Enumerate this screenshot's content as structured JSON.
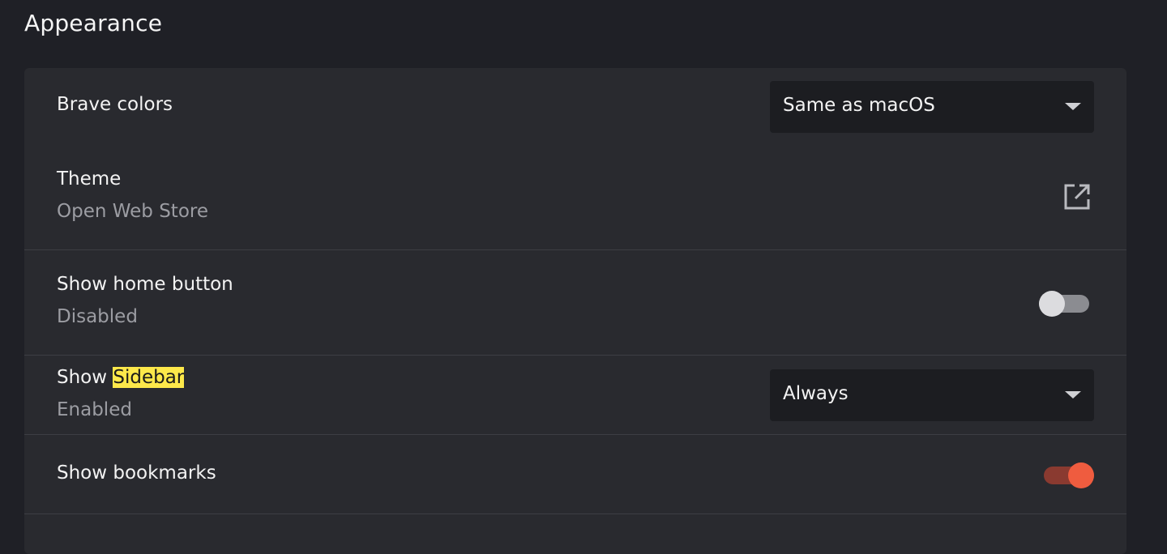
{
  "section": {
    "title": "Appearance"
  },
  "settings": {
    "brave_colors": {
      "label": "Brave colors",
      "value": "Same as macOS"
    },
    "theme": {
      "label": "Theme",
      "sublabel": "Open Web Store",
      "icon": "external-link-icon"
    },
    "home_button": {
      "label": "Show home button",
      "sublabel": "Disabled",
      "enabled": false
    },
    "sidebar": {
      "label_prefix": "Show",
      "label_highlight": "Sidebar",
      "sublabel": "Enabled",
      "value": "Always"
    },
    "bookmarks": {
      "label": "Show bookmarks",
      "enabled": true
    }
  },
  "colors": {
    "accent": "#ef5c3f",
    "search_highlight": "#fde84a"
  }
}
